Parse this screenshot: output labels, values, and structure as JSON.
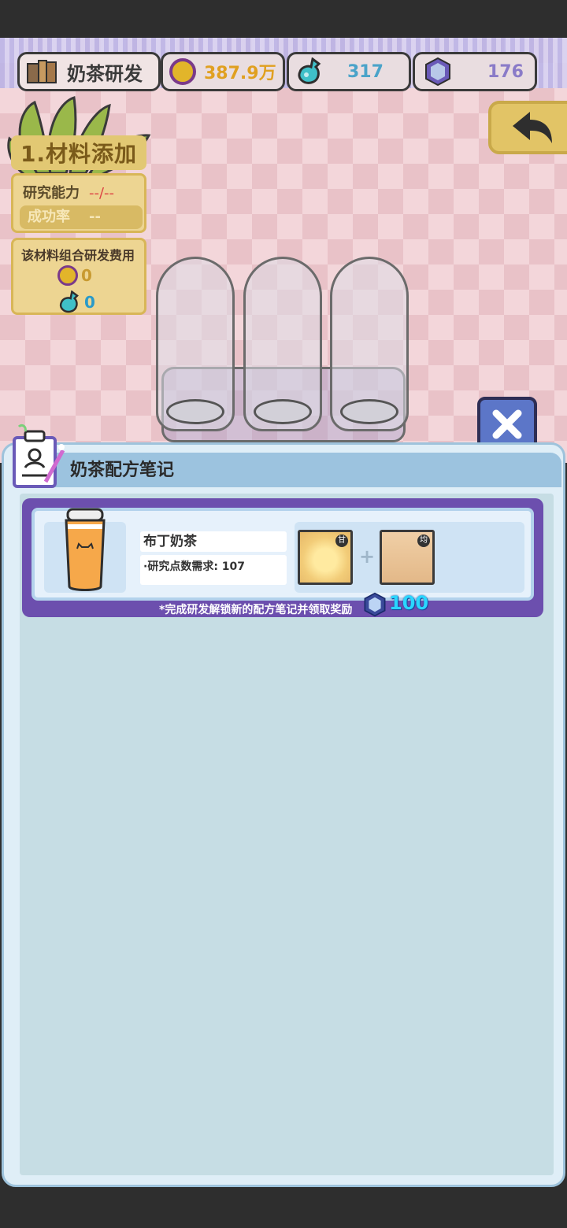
{
  "header": {
    "title": "奶茶研发",
    "coins": "387.9万",
    "potions": "317",
    "gems": "176"
  },
  "left_panel": {
    "step_title": "1.材料添加",
    "research_label": "研究能力",
    "research_value": "--/--",
    "success_label": "成功率",
    "success_value": "--",
    "cost_title": "该材料组合研发费用",
    "cost_coins": "0",
    "cost_potions": "0"
  },
  "dialog": {
    "title": "奶茶配方笔记",
    "recipe": {
      "name": "布丁奶茶",
      "requirement": "·研究点数需求: 107",
      "ingredient1_tag": "甘",
      "ingredient2_tag": "均",
      "plus": "+"
    },
    "reward_text": "*完成研发解锁新的配方笔记并领取奖励",
    "reward_value": "100"
  },
  "icons": {
    "title_icon": "book-icon",
    "coin": "coin-icon",
    "potion": "potion-icon",
    "gem": "gem-icon",
    "back": "back-arrow-icon",
    "close": "close-icon",
    "note": "recipe-note-icon"
  },
  "colors": {
    "coin_text": "#e0a020",
    "potion_text": "#4aa3c9",
    "gem_text": "#8a7bc8",
    "card_bg": "#6c4fae",
    "close_bg": "#5c76c8",
    "back_bg": "#e2c466"
  }
}
